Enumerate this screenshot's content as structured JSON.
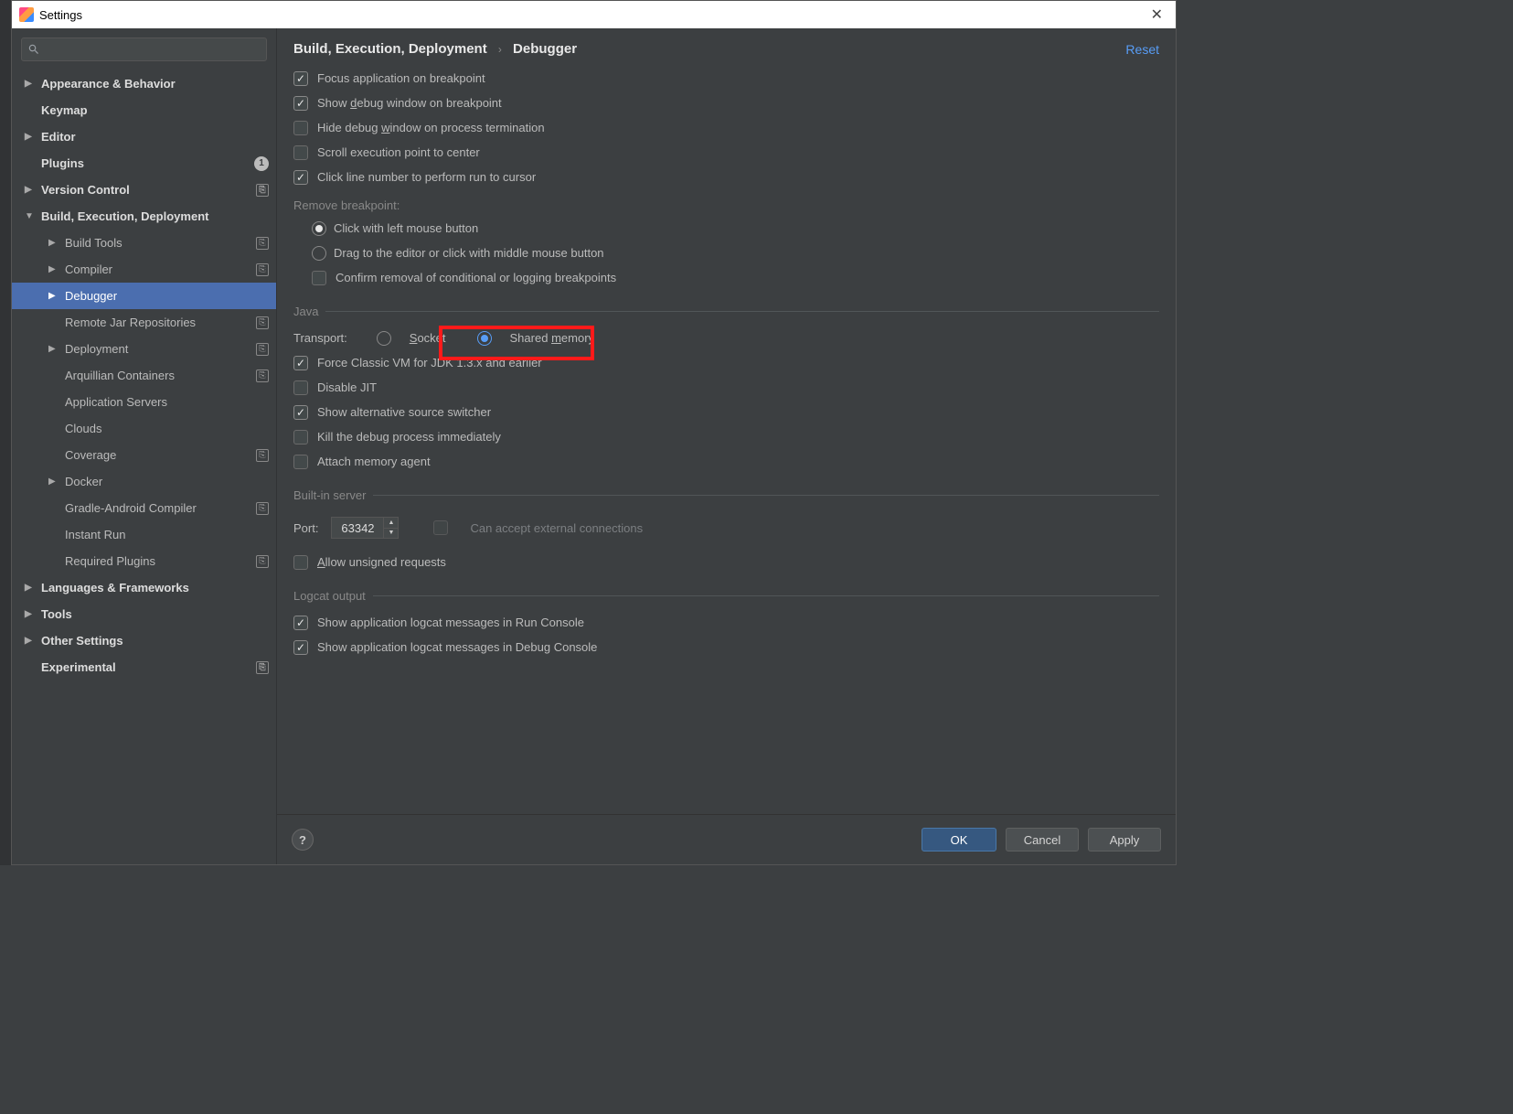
{
  "window": {
    "title": "Settings"
  },
  "search": {
    "placeholder": ""
  },
  "sidebar": {
    "items": [
      {
        "label": "Appearance & Behavior",
        "bold": true,
        "arrow": "▶"
      },
      {
        "label": "Keymap",
        "bold": true
      },
      {
        "label": "Editor",
        "bold": true,
        "arrow": "▶"
      },
      {
        "label": "Plugins",
        "bold": true,
        "badge": "1"
      },
      {
        "label": "Version Control",
        "bold": true,
        "arrow": "▶",
        "tag": true
      },
      {
        "label": "Build, Execution, Deployment",
        "bold": true,
        "arrow": "▼"
      },
      {
        "label": "Build Tools",
        "indent": 1,
        "arrow": "▶",
        "tag": true
      },
      {
        "label": "Compiler",
        "indent": 1,
        "arrow": "▶",
        "tag": true
      },
      {
        "label": "Debugger",
        "indent": 1,
        "arrow": "▶",
        "selected": true
      },
      {
        "label": "Remote Jar Repositories",
        "indent": 1,
        "tag": true
      },
      {
        "label": "Deployment",
        "indent": 1,
        "arrow": "▶",
        "tag": true
      },
      {
        "label": "Arquillian Containers",
        "indent": 1,
        "tag": true
      },
      {
        "label": "Application Servers",
        "indent": 1
      },
      {
        "label": "Clouds",
        "indent": 1
      },
      {
        "label": "Coverage",
        "indent": 1,
        "tag": true
      },
      {
        "label": "Docker",
        "indent": 1,
        "arrow": "▶"
      },
      {
        "label": "Gradle-Android Compiler",
        "indent": 1,
        "tag": true
      },
      {
        "label": "Instant Run",
        "indent": 1
      },
      {
        "label": "Required Plugins",
        "indent": 1,
        "tag": true
      },
      {
        "label": "Languages & Frameworks",
        "bold": true,
        "arrow": "▶"
      },
      {
        "label": "Tools",
        "bold": true,
        "arrow": "▶"
      },
      {
        "label": "Other Settings",
        "bold": true,
        "arrow": "▶"
      },
      {
        "label": "Experimental",
        "bold": true,
        "tag": true
      }
    ]
  },
  "header": {
    "crumb1": "Build, Execution, Deployment",
    "crumb2": "Debugger",
    "reset": "Reset"
  },
  "opts": {
    "focus": "Focus application on breakpoint",
    "showdbg": "Show debug window on breakpoint",
    "hidedbg": "Hide debug window on process termination",
    "scroll": "Scroll execution point to center",
    "clickline": "Click line number to perform run to cursor",
    "remove_label": "Remove breakpoint:",
    "remove_click": "Click with left mouse button",
    "remove_drag": "Drag to the editor or click with middle mouse button",
    "remove_confirm": "Confirm removal of conditional or logging breakpoints"
  },
  "java": {
    "legend": "Java",
    "transport": "Transport:",
    "socket": "Socket",
    "shared": "Shared memory",
    "force": "Force Classic VM for JDK 1.3.x and earlier",
    "jit": "Disable JIT",
    "alt": "Show alternative source switcher",
    "kill": "Kill the debug process immediately",
    "attach": "Attach memory agent"
  },
  "server": {
    "legend": "Built-in server",
    "port_label": "Port:",
    "port_value": "63342",
    "ext": "Can accept external connections",
    "unsigned": "Allow unsigned requests"
  },
  "logcat": {
    "legend": "Logcat output",
    "run": "Show application logcat messages in Run Console",
    "debug": "Show application logcat messages in Debug Console"
  },
  "buttons": {
    "ok": "OK",
    "cancel": "Cancel",
    "apply": "Apply",
    "help": "?"
  }
}
